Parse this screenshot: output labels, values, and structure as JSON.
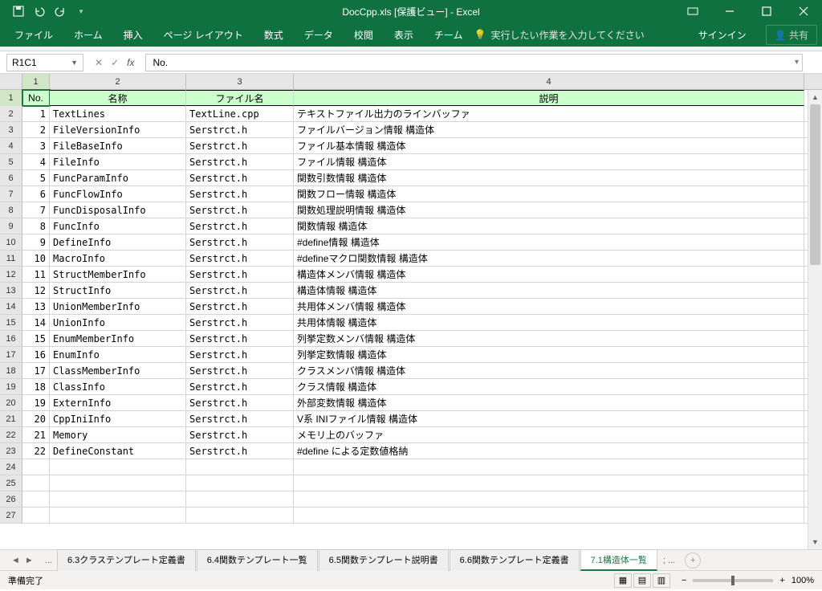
{
  "title": "DocCpp.xls [保護ビュー] - Excel",
  "qat": {
    "save": "save",
    "undo": "undo",
    "redo": "redo"
  },
  "ribbon": {
    "tabs": [
      "ファイル",
      "ホーム",
      "挿入",
      "ページ レイアウト",
      "数式",
      "データ",
      "校閲",
      "表示",
      "チーム"
    ],
    "tell_me": "実行したい作業を入力してください",
    "signin": "サインイン",
    "share": "共有"
  },
  "namebox": "R1C1",
  "formula": "No.",
  "columns": [
    "1",
    "2",
    "3",
    "4"
  ],
  "header_row": {
    "no": "No.",
    "name": "名称",
    "file": "ファイル名",
    "desc": "説明"
  },
  "rows": [
    {
      "r": "2",
      "no": "1",
      "name": "TextLines",
      "file": "TextLine.cpp",
      "desc": "テキストファイル出力のラインバッファ"
    },
    {
      "r": "3",
      "no": "2",
      "name": "FileVersionInfo",
      "file": "Serstrct.h",
      "desc": "ファイルバージョン情報 構造体"
    },
    {
      "r": "4",
      "no": "3",
      "name": "FileBaseInfo",
      "file": "Serstrct.h",
      "desc": "ファイル基本情報 構造体"
    },
    {
      "r": "5",
      "no": "4",
      "name": "FileInfo",
      "file": "Serstrct.h",
      "desc": "ファイル情報 構造体"
    },
    {
      "r": "6",
      "no": "5",
      "name": "FuncParamInfo",
      "file": "Serstrct.h",
      "desc": "関数引数情報 構造体"
    },
    {
      "r": "7",
      "no": "6",
      "name": "FuncFlowInfo",
      "file": "Serstrct.h",
      "desc": "関数フロー情報 構造体"
    },
    {
      "r": "8",
      "no": "7",
      "name": "FuncDisposalInfo",
      "file": "Serstrct.h",
      "desc": "関数処理説明情報 構造体"
    },
    {
      "r": "9",
      "no": "8",
      "name": "FuncInfo",
      "file": "Serstrct.h",
      "desc": "関数情報 構造体"
    },
    {
      "r": "10",
      "no": "9",
      "name": "DefineInfo",
      "file": "Serstrct.h",
      "desc": "#define情報 構造体"
    },
    {
      "r": "11",
      "no": "10",
      "name": "MacroInfo",
      "file": "Serstrct.h",
      "desc": "#defineマクロ関数情報 構造体"
    },
    {
      "r": "12",
      "no": "11",
      "name": "StructMemberInfo",
      "file": "Serstrct.h",
      "desc": "構造体メンバ情報 構造体"
    },
    {
      "r": "13",
      "no": "12",
      "name": "StructInfo",
      "file": "Serstrct.h",
      "desc": "構造体情報 構造体"
    },
    {
      "r": "14",
      "no": "13",
      "name": "UnionMemberInfo",
      "file": "Serstrct.h",
      "desc": "共用体メンバ情報 構造体"
    },
    {
      "r": "15",
      "no": "14",
      "name": "UnionInfo",
      "file": "Serstrct.h",
      "desc": "共用体情報 構造体"
    },
    {
      "r": "16",
      "no": "15",
      "name": "EnumMemberInfo",
      "file": "Serstrct.h",
      "desc": "列挙定数メンバ情報 構造体"
    },
    {
      "r": "17",
      "no": "16",
      "name": "EnumInfo",
      "file": "Serstrct.h",
      "desc": "列挙定数情報 構造体"
    },
    {
      "r": "18",
      "no": "17",
      "name": "ClassMemberInfo",
      "file": "Serstrct.h",
      "desc": "クラスメンバ情報 構造体"
    },
    {
      "r": "19",
      "no": "18",
      "name": "ClassInfo",
      "file": "Serstrct.h",
      "desc": "クラス情報 構造体"
    },
    {
      "r": "20",
      "no": "19",
      "name": "ExternInfo",
      "file": "Serstrct.h",
      "desc": "外部変数情報 構造体"
    },
    {
      "r": "21",
      "no": "20",
      "name": "CppIniInfo",
      "file": "Serstrct.h",
      "desc": "V系 INIファイル情報 構造体"
    },
    {
      "r": "22",
      "no": "21",
      "name": "Memory",
      "file": "Serstrct.h",
      "desc": "メモリ上のバッファ"
    },
    {
      "r": "23",
      "no": "22",
      "name": "DefineConstant",
      "file": "Serstrct.h",
      "desc": "#define による定数値格納"
    }
  ],
  "empty_rows": [
    "24",
    "25",
    "26",
    "27"
  ],
  "sheet_tabs": {
    "more_left": "...",
    "tabs": [
      "6.3クラステンプレート定義書",
      "6.4関数テンプレート一覧",
      "6.5関数テンプレート説明書",
      "6.6関数テンプレート定義書",
      "7.1構造体一覧"
    ],
    "active_index": 4,
    "more_right": "; ..."
  },
  "status": {
    "ready": "準備完了",
    "zoom": "100%"
  }
}
